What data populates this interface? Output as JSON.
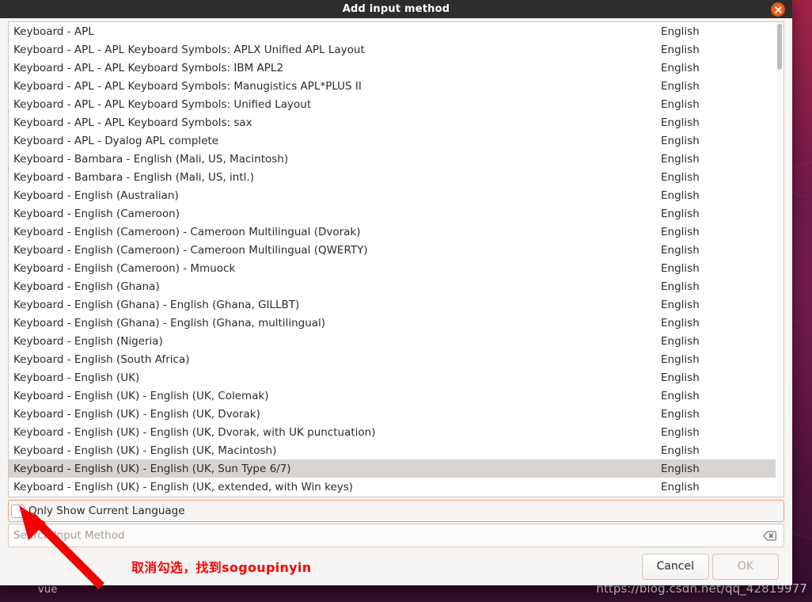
{
  "window": {
    "title": "Add input method",
    "close_icon": "close-icon"
  },
  "list": {
    "lang_column_header": "English",
    "selected_index": 24,
    "rows": [
      {
        "name": "Keyboard - APL",
        "lang": "English"
      },
      {
        "name": "Keyboard - APL - APL Keyboard Symbols: APLX Unified APL Layout",
        "lang": "English"
      },
      {
        "name": "Keyboard - APL - APL Keyboard Symbols: IBM APL2",
        "lang": "English"
      },
      {
        "name": "Keyboard - APL - APL Keyboard Symbols: Manugistics APL*PLUS II",
        "lang": "English"
      },
      {
        "name": "Keyboard - APL - APL Keyboard Symbols: Unified Layout",
        "lang": "English"
      },
      {
        "name": "Keyboard - APL - APL Keyboard Symbols: sax",
        "lang": "English"
      },
      {
        "name": "Keyboard - APL - Dyalog APL complete",
        "lang": "English"
      },
      {
        "name": "Keyboard - Bambara - English (Mali, US, Macintosh)",
        "lang": "English"
      },
      {
        "name": "Keyboard - Bambara - English (Mali, US, intl.)",
        "lang": "English"
      },
      {
        "name": "Keyboard - English (Australian)",
        "lang": "English"
      },
      {
        "name": "Keyboard - English (Cameroon)",
        "lang": "English"
      },
      {
        "name": "Keyboard - English (Cameroon) - Cameroon Multilingual (Dvorak)",
        "lang": "English"
      },
      {
        "name": "Keyboard - English (Cameroon) - Cameroon Multilingual (QWERTY)",
        "lang": "English"
      },
      {
        "name": "Keyboard - English (Cameroon) - Mmuock",
        "lang": "English"
      },
      {
        "name": "Keyboard - English (Ghana)",
        "lang": "English"
      },
      {
        "name": "Keyboard - English (Ghana) - English (Ghana, GILLBT)",
        "lang": "English"
      },
      {
        "name": "Keyboard - English (Ghana) - English (Ghana, multilingual)",
        "lang": "English"
      },
      {
        "name": "Keyboard - English (Nigeria)",
        "lang": "English"
      },
      {
        "name": "Keyboard - English (South Africa)",
        "lang": "English"
      },
      {
        "name": "Keyboard - English (UK)",
        "lang": "English"
      },
      {
        "name": "Keyboard - English (UK) - English (UK, Colemak)",
        "lang": "English"
      },
      {
        "name": "Keyboard - English (UK) - English (UK, Dvorak)",
        "lang": "English"
      },
      {
        "name": "Keyboard - English (UK) - English (UK, Dvorak, with UK punctuation)",
        "lang": "English"
      },
      {
        "name": "Keyboard - English (UK) - English (UK, Macintosh)",
        "lang": "English"
      },
      {
        "name": "Keyboard - English (UK) - English (UK, Sun Type 6/7)",
        "lang": "English"
      },
      {
        "name": "Keyboard - English (UK) - English (UK, extended, with Win keys)",
        "lang": "English"
      }
    ]
  },
  "options": {
    "only_current_language_label": "Only Show Current Language",
    "only_current_language_checked": false
  },
  "search": {
    "value": "",
    "placeholder": "Search Input Method",
    "clear_icon": "clear-backspace-icon"
  },
  "buttons": {
    "cancel_label": "Cancel",
    "ok_label": "OK",
    "ok_disabled": true
  },
  "annotations": {
    "text": "取消勾选，找到sogoupinyin",
    "color": "#ff0000"
  },
  "desktop": {
    "taskbar_item": "vue",
    "watermark": "https://blog.csdn.net/qq_42819977"
  },
  "colors": {
    "titlebar_bg": "#2f2d2c",
    "close_button": "#e8601c",
    "dialog_bg": "#f6f5f4",
    "selected_row": "#d6d3d0",
    "focus_border": "#f0a07a",
    "annotation_red": "#ff0000"
  }
}
